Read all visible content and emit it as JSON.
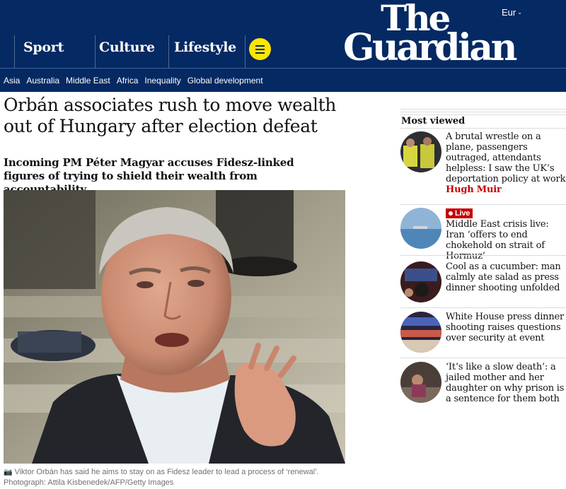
{
  "header": {
    "edition": "Eur",
    "logo_line1": "The",
    "logo_line2": "Guardian",
    "pillars": [
      "Sport",
      "Culture",
      "Lifestyle"
    ],
    "menu_icon": "hamburger-icon"
  },
  "subnav": {
    "items": [
      "Asia",
      "Australia",
      "Middle East",
      "Africa",
      "Inequality",
      "Global development"
    ]
  },
  "article": {
    "headline": "Orbán associates rush to move wealth out of Hungary after election defeat",
    "standfirst": "Incoming PM Péter Magyar accuses Fidesz-linked figures of trying to shield their wealth from accountability",
    "caption": "Viktor Orbán has said he aims to stay on as Fidesz leader to lead a process of ‘renewal’. Photograph: Attila Kisbenedek/AFP/Getty Images",
    "caption_icon": "camera-icon"
  },
  "most_viewed": {
    "title": "Most viewed",
    "items": [
      {
        "text": "A brutal wrestle on a plane, passengers outraged, attendants helpless: I saw the UK’s deportation policy at work",
        "author": "Hugh Muir"
      },
      {
        "badge": "Live",
        "text": "Middle East crisis live: Iran ‘offers to end chokehold on strait of Hormuz’"
      },
      {
        "text": "Cool as a cucumber: man calmly ate salad as press dinner shooting unfolded"
      },
      {
        "text": "White House press dinner shooting raises questions over security at event"
      },
      {
        "text": "‘It’s like a slow death’: a jailed mother and her daughter on why prison is a sentence for them both"
      }
    ]
  },
  "colors": {
    "brand_blue": "#052962",
    "menu_yellow": "#ffe500",
    "news_red": "#c70000"
  }
}
